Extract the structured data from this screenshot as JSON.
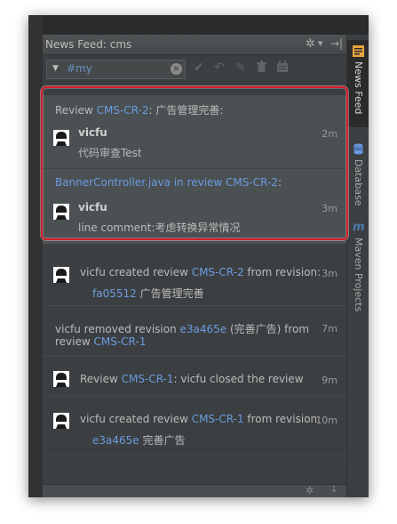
{
  "window": {
    "title": "News Feed: cms"
  },
  "filter": {
    "value": "#my"
  },
  "right_tabs": [
    "News Feed",
    "Database",
    "Maven Projects"
  ],
  "feed": [
    {
      "header": {
        "prefix": "Review ",
        "link": "CMS-CR-2",
        "suffix": ": 广告管理完善:"
      },
      "user": "vicfu",
      "time": "2m",
      "message": "代码审查Test"
    },
    {
      "header": {
        "link1": "BannerController.java",
        "middle": " in review ",
        "link2": "CMS-CR-2",
        "suffix": ":"
      },
      "user": "vicfu",
      "time": "3m",
      "message": "line comment:考虑转换异常情况"
    },
    {
      "line1": {
        "prefix": "vicfu created review ",
        "link": "CMS-CR-2",
        "suffix": " from revision:"
      },
      "line2": {
        "link": "fa05512",
        "suffix": " 广告管理完善"
      },
      "time": "3m"
    },
    {
      "line1": {
        "prefix": "vicfu removed revision ",
        "link": "e3a465e",
        "suffix": " (完善广告) from"
      },
      "line2": {
        "prefix": "review ",
        "link": "CMS-CR-1"
      },
      "time": "7m"
    },
    {
      "line1": {
        "prefix": "Review ",
        "link": "CMS-CR-1",
        "suffix": ": vicfu closed the review"
      },
      "time": "9m"
    },
    {
      "line1": {
        "prefix": "vicfu created review ",
        "link": "CMS-CR-1",
        "suffix": " from revision:"
      },
      "line2": {
        "link": "e3a465e",
        "suffix": " 完善广告"
      },
      "time": "10m"
    }
  ]
}
